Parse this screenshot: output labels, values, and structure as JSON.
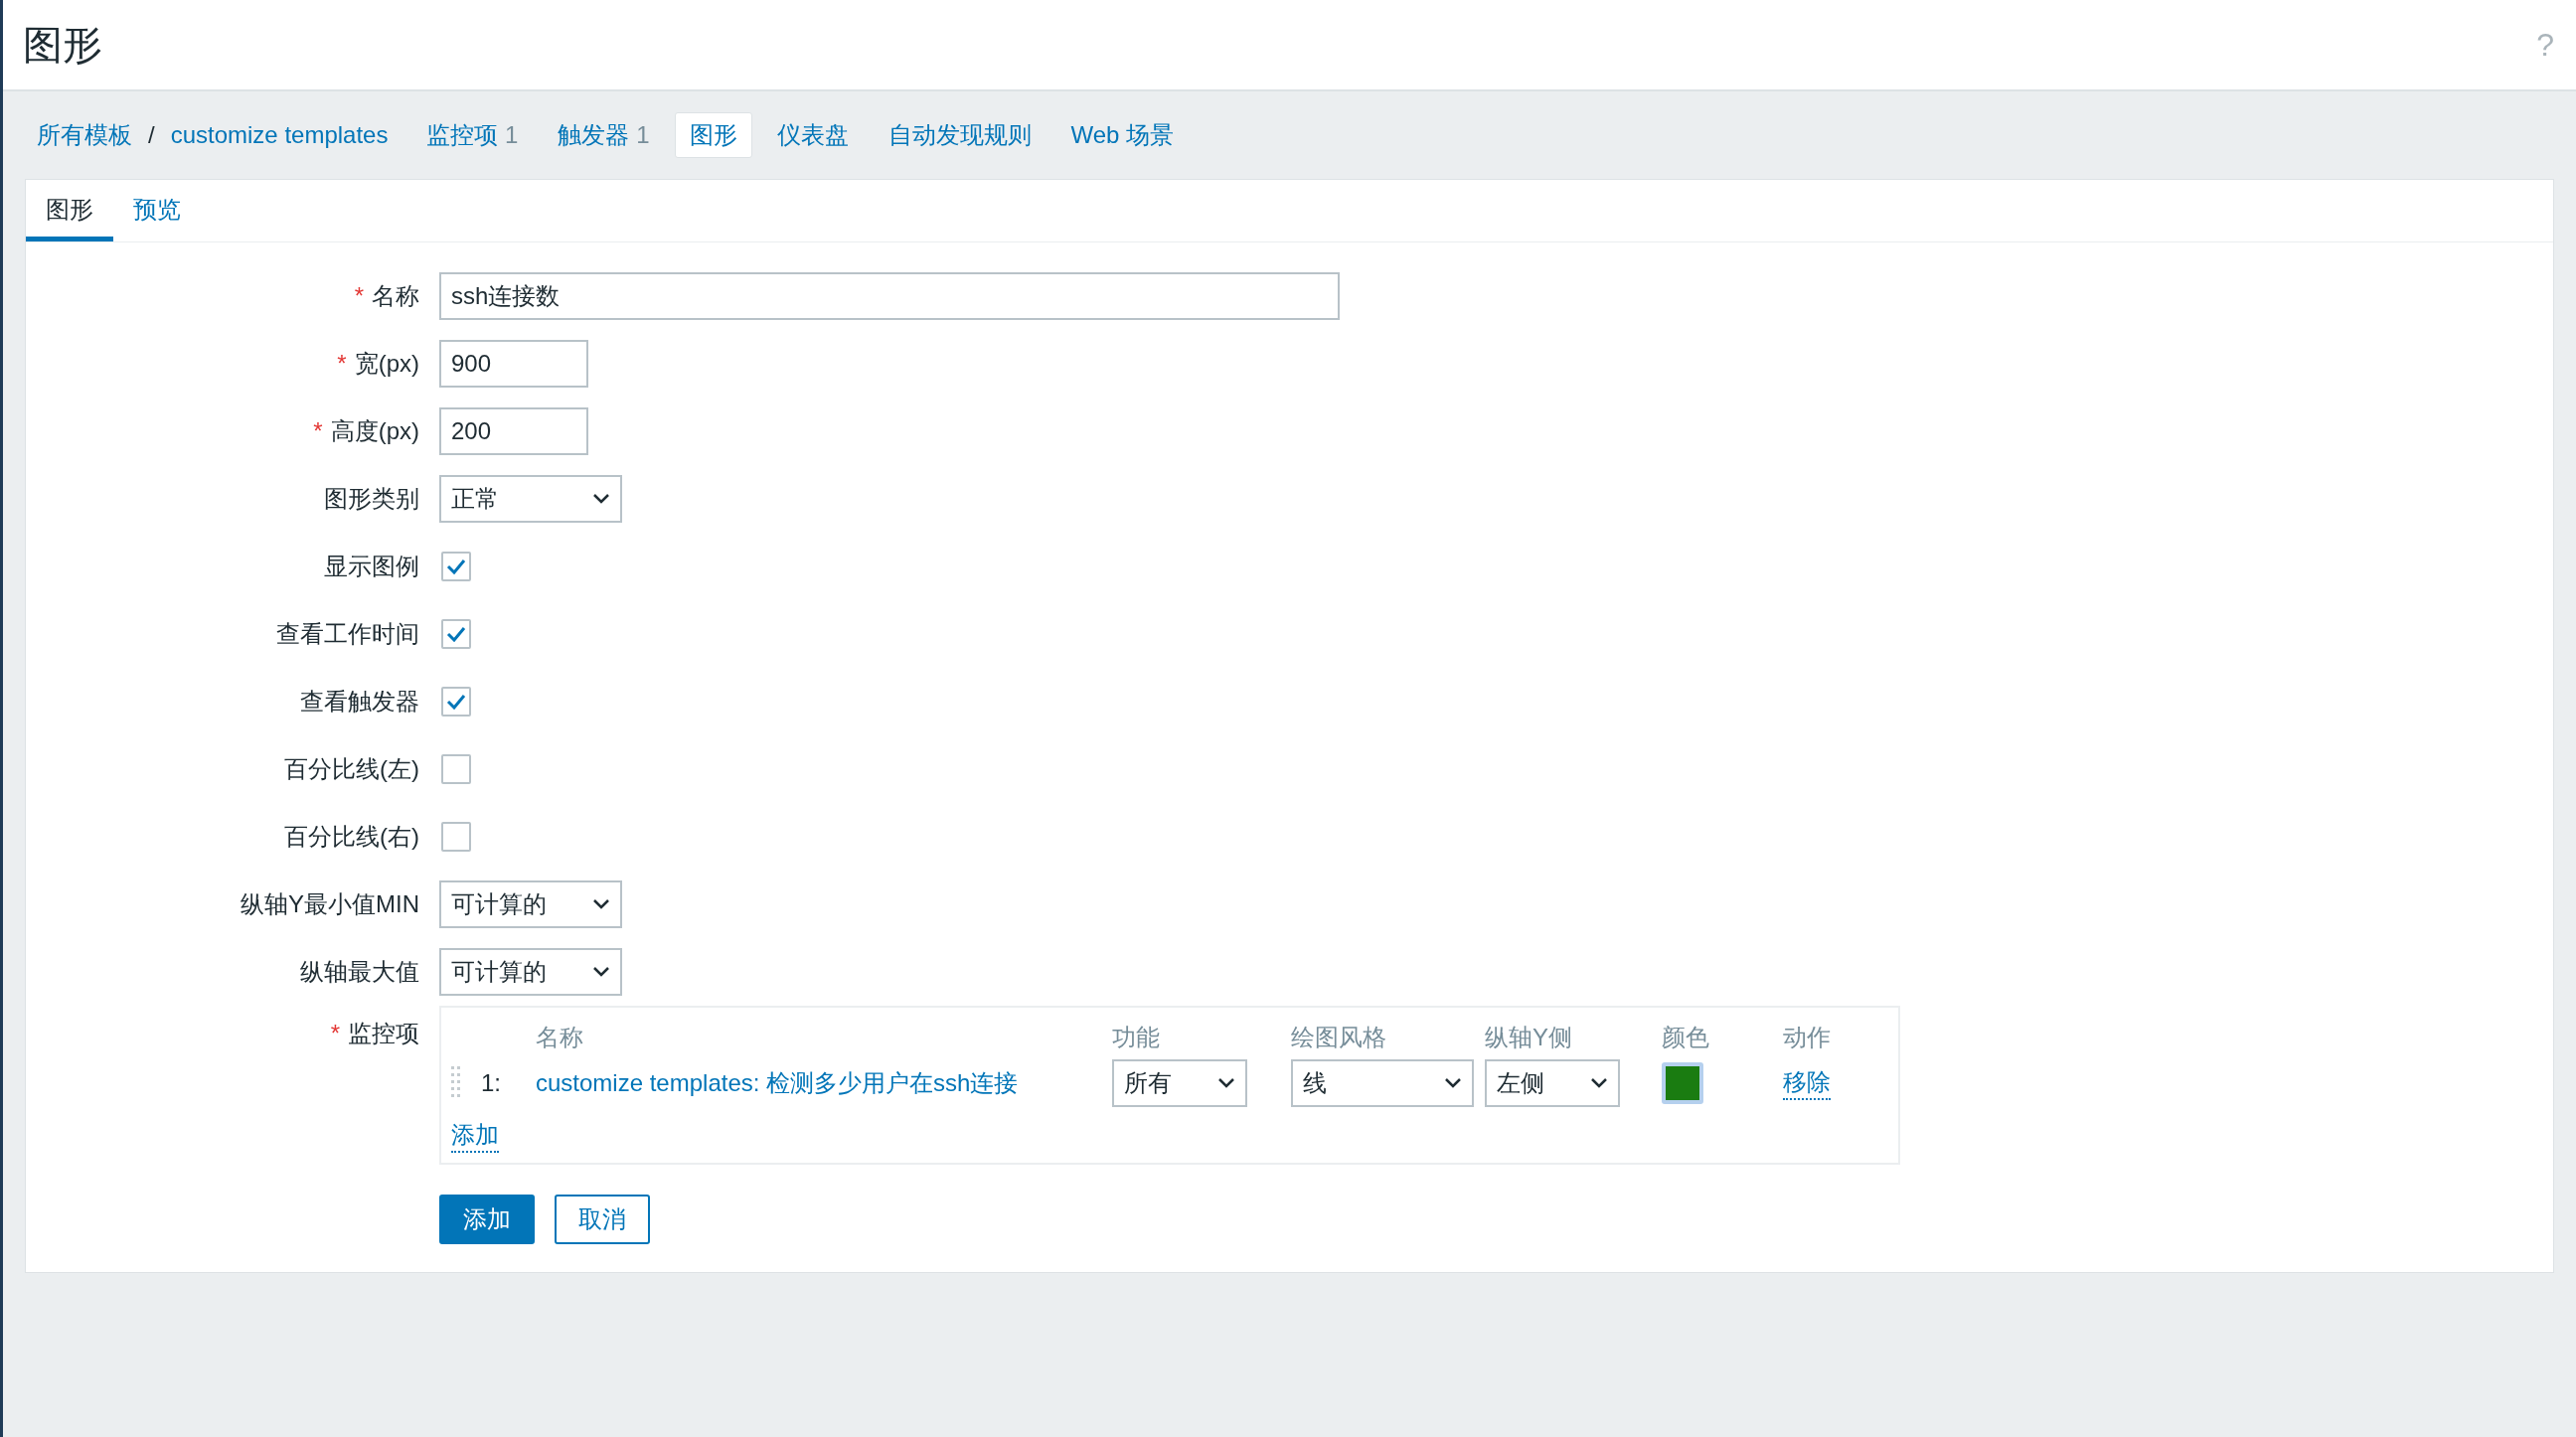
{
  "page_title": "图形",
  "help": "?",
  "breadcrumbs": [
    {
      "label": "所有模板"
    },
    {
      "label": "customize templates"
    }
  ],
  "breadcrumb_separator": "/",
  "nav_tabs": [
    {
      "label": "监控项",
      "count": "1",
      "selected": false
    },
    {
      "label": "触发器",
      "count": "1",
      "selected": false
    },
    {
      "label": "图形",
      "selected": true
    },
    {
      "label": "仪表盘",
      "selected": false
    },
    {
      "label": "自动发现规则",
      "selected": false
    },
    {
      "label": "Web 场景",
      "selected": false
    }
  ],
  "form_tabs": [
    {
      "label": "图形",
      "selected": true
    },
    {
      "label": "预览",
      "selected": false
    }
  ],
  "fields": [
    {
      "kind": "text",
      "label": "名称",
      "required_mark": "*",
      "value": "ssh连接数",
      "wide": true
    },
    {
      "kind": "text",
      "label": "宽(px)",
      "required_mark": "*",
      "value": "900",
      "wide": false
    },
    {
      "kind": "text",
      "label": "高度(px)",
      "required_mark": "*",
      "value": "200",
      "wide": false
    },
    {
      "kind": "select",
      "label": "图形类别",
      "value": "正常"
    },
    {
      "kind": "checkbox",
      "label": "显示图例",
      "checked": true
    },
    {
      "kind": "checkbox",
      "label": "查看工作时间",
      "checked": true
    },
    {
      "kind": "checkbox",
      "label": "查看触发器",
      "checked": true
    },
    {
      "kind": "checkbox",
      "label": "百分比线(左)",
      "checked": false
    },
    {
      "kind": "checkbox",
      "label": "百分比线(右)",
      "checked": false
    },
    {
      "kind": "select",
      "label": "纵轴Y最小值MIN",
      "value": "可计算的"
    },
    {
      "kind": "select",
      "label": "纵轴最大值",
      "value": "可计算的"
    }
  ],
  "items": {
    "label": "监控项",
    "required_mark": "*",
    "columns": [
      "名称",
      "功能",
      "绘图风格",
      "纵轴Y侧",
      "颜色",
      "动作"
    ],
    "rows": [
      {
        "index": "1:",
        "name": "customize templates: 检测多少用户在ssh连接",
        "function": "所有",
        "draw_style": "线",
        "y_axis": "左侧",
        "color": "#1a7c11",
        "action": "移除"
      }
    ],
    "add_link": "添加"
  },
  "buttons": [
    {
      "label": "添加",
      "kind": "primary"
    },
    {
      "label": "取消",
      "kind": "secondary"
    }
  ]
}
